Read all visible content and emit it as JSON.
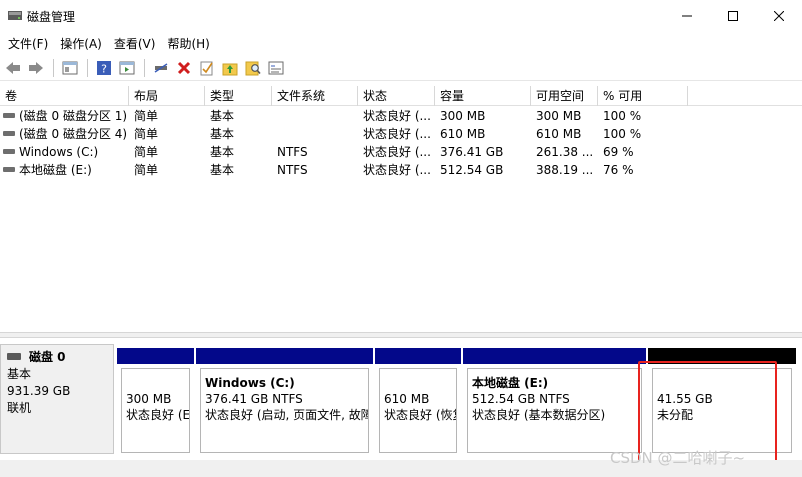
{
  "window": {
    "title": "磁盘管理",
    "minimize": "—",
    "maximize": "☐",
    "close": "✕"
  },
  "menu": [
    "文件(F)",
    "操作(A)",
    "查看(V)",
    "帮助(H)"
  ],
  "toolbar": {
    "icons": [
      "back-icon",
      "forward-icon",
      "console-icon",
      "help-icon",
      "properties-icon",
      "connect-icon",
      "delete-icon",
      "check-icon",
      "folder-up-icon",
      "search-icon",
      "list-icon"
    ]
  },
  "table": {
    "headers": [
      "卷",
      "布局",
      "类型",
      "文件系统",
      "状态",
      "容量",
      "可用空间",
      "% 可用"
    ],
    "rows": [
      [
        "(磁盘 0 磁盘分区 1)",
        "简单",
        "基本",
        "",
        "状态良好 (...",
        "300 MB",
        "300 MB",
        "100 %"
      ],
      [
        "(磁盘 0 磁盘分区 4)",
        "简单",
        "基本",
        "",
        "状态良好 (...",
        "610 MB",
        "610 MB",
        "100 %"
      ],
      [
        "Windows (C:)",
        "简单",
        "基本",
        "NTFS",
        "状态良好 (...",
        "376.41 GB",
        "261.38 ...",
        "69 %"
      ],
      [
        "本地磁盘 (E:)",
        "简单",
        "基本",
        "NTFS",
        "状态良好 (...",
        "512.54 GB",
        "388.19 ...",
        "76 %"
      ]
    ]
  },
  "disk": {
    "name": "磁盘 0",
    "type": "基本",
    "size": "931.39 GB",
    "status": "联机"
  },
  "partitions": [
    {
      "title": "",
      "line1": "300 MB",
      "line2": "状态良好 (E"
    },
    {
      "title": "Windows  (C:)",
      "line1": "376.41 GB NTFS",
      "line2": "状态良好 (启动, 页面文件, 故障"
    },
    {
      "title": "",
      "line1": "610 MB",
      "line2": "状态良好 (恢复"
    },
    {
      "title": "本地磁盘  (E:)",
      "line1": "512.54 GB NTFS",
      "line2": "状态良好 (基本数据分区)"
    },
    {
      "title": "",
      "line1": "41.55 GB",
      "line2": "未分配"
    }
  ],
  "watermark": "CSDN @二哈喇子~",
  "colors": {
    "primary_partition_bar": "#03088a",
    "unallocated_bar": "#000000",
    "highlight_box": "#e8231e"
  }
}
